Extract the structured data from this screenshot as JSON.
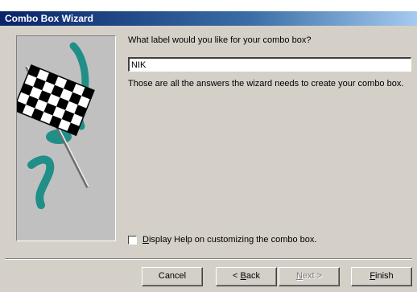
{
  "window": {
    "title": "Combo Box Wizard"
  },
  "main": {
    "prompt": "What label would you like for your combo box?",
    "label_value": "NIK",
    "info": "Those are all the answers the wizard needs to create your combo box.",
    "help_checkbox": {
      "checked": false,
      "label_prefix": "",
      "label_accel": "D",
      "label_rest": "isplay Help on customizing the combo box."
    }
  },
  "buttons": {
    "cancel": "Cancel",
    "back_accel": "B",
    "back_rest": "ack",
    "back_prefix": "< ",
    "next_accel": "N",
    "next_rest": "ext >",
    "finish_accel": "F",
    "finish_rest": "inish"
  },
  "colors": {
    "dialog_bg": "#d4d0c8",
    "title_start": "#0a246a",
    "art_teal": "#1f8f88"
  },
  "icons": {
    "wizard_art": "checkered-flag-icon"
  }
}
